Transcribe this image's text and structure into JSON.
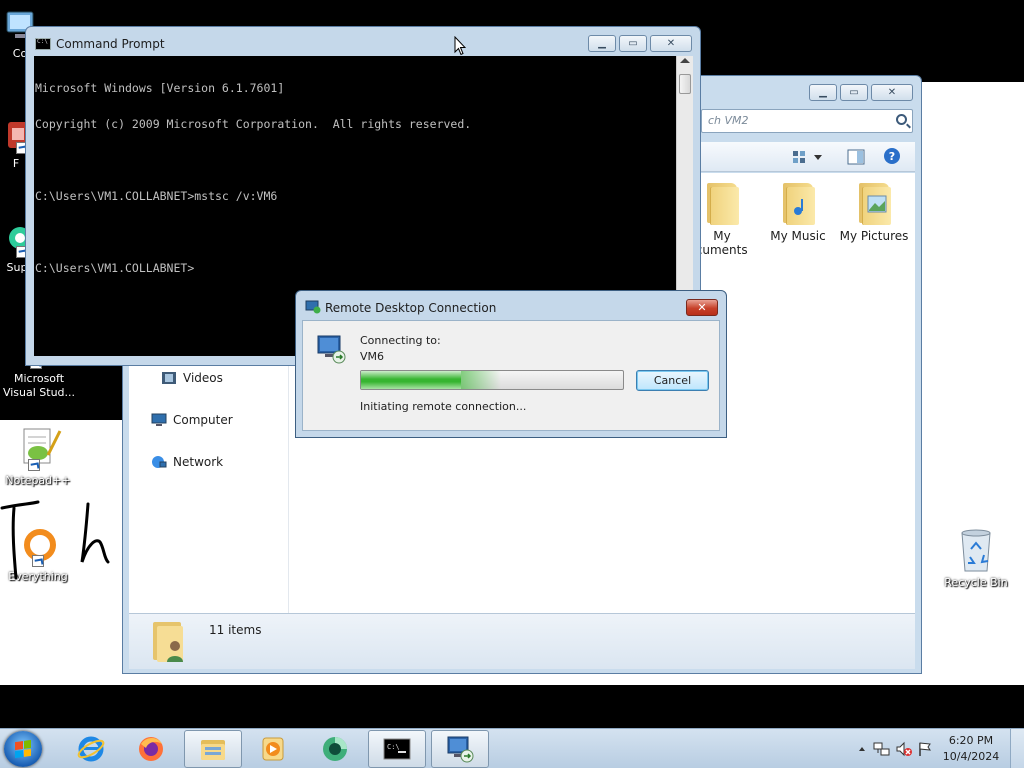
{
  "desktop": {
    "icons": [
      {
        "label": "Co",
        "name": "computer"
      },
      {
        "label": "F",
        "name": "app-f"
      },
      {
        "label": "Sup",
        "name": "support"
      },
      {
        "label": "Microsoft Visual Stud...",
        "name": "visual-studio"
      },
      {
        "label": "Notepad++",
        "name": "notepad-plus-plus"
      },
      {
        "label": "Everything",
        "name": "everything"
      },
      {
        "label": "Recycle Bin",
        "name": "recycle-bin"
      }
    ],
    "annotation_text": "Toh"
  },
  "cmd": {
    "title": "Command Prompt",
    "lines": [
      "Microsoft Windows [Version 6.1.7601]",
      "Copyright (c) 2009 Microsoft Corporation.  All rights reserved.",
      "",
      "C:\\Users\\VM1.COLLABNET>mstsc /v:VM6",
      "",
      "C:\\Users\\VM1.COLLABNET>"
    ]
  },
  "explorer": {
    "search_placeholder": "ch VM2",
    "folders": [
      {
        "label": "My",
        "label2": "ocuments"
      },
      {
        "label": "My Music",
        "label2": ""
      },
      {
        "label": "My Pictures",
        "label2": ""
      }
    ],
    "nav": {
      "videos": "Videos",
      "computer": "Computer",
      "network": "Network"
    },
    "status": "11 items"
  },
  "rdp": {
    "title": "Remote Desktop Connection",
    "connecting_to": "Connecting to:",
    "target": "VM6",
    "progress": 0.38,
    "status": "Initiating remote connection...",
    "cancel": "Cancel"
  },
  "taskbar": {
    "time": "6:20 PM",
    "date": "10/4/2024"
  },
  "colors": {
    "window_frame": "#c5d8ea",
    "console_bg": "#000000",
    "console_text": "#c0c0c0",
    "progress_green": "#37b531",
    "close_red": "#c7412a"
  }
}
